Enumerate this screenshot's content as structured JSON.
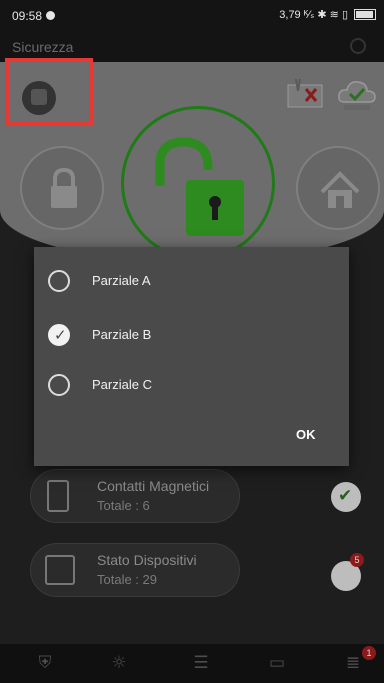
{
  "status_bar": {
    "time": "09:58",
    "indicators": "3,79 ᴷ⁄ₛ ✱ ≋ ▯",
    "battery": "89"
  },
  "header": {
    "title": "Sicurezza"
  },
  "security_panel": {
    "left_circle_icon": "lock-icon",
    "center_icon": "open-padlock-icon",
    "right_circle_icon": "home-icon",
    "accent_color": "#2e8b1f"
  },
  "device_rows": [
    {
      "title": "Contatti Magnetici",
      "subtitle": "Totale : 6",
      "status_icon": "check-icon"
    },
    {
      "title": "Stato Dispositivi",
      "subtitle": "Totale : 29",
      "status_icon": "warning-icon",
      "badge": "5"
    }
  ],
  "dialog": {
    "options": [
      {
        "label": "Parziale A",
        "checked": false
      },
      {
        "label": "Parziale B",
        "checked": true
      },
      {
        "label": "Parziale C",
        "checked": false
      }
    ],
    "ok_label": "OK"
  },
  "bottom_nav": {
    "items": [
      "shield-icon",
      "sun-icon",
      "sliders-icon",
      "camera-icon",
      "list-icon"
    ],
    "list_badge": "1"
  }
}
